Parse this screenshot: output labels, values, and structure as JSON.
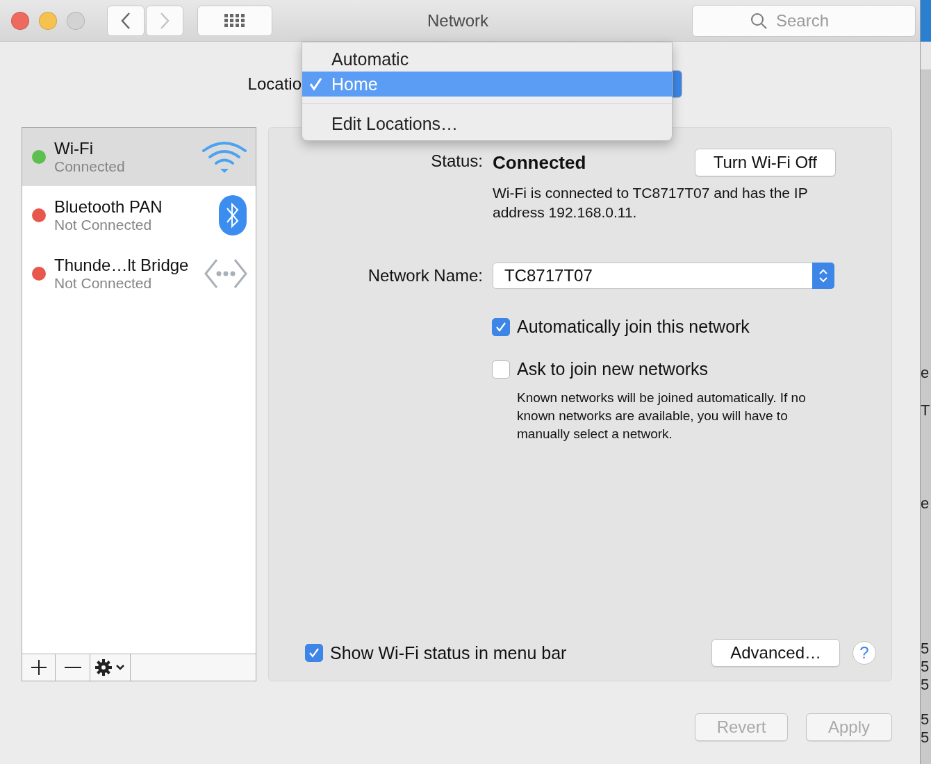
{
  "window": {
    "title": "Network",
    "search_placeholder": "Search"
  },
  "location": {
    "label": "Locatio",
    "menu_items": [
      {
        "label": "Automatic",
        "selected": false
      },
      {
        "label": "Home",
        "selected": true
      }
    ],
    "menu_action": "Edit Locations…"
  },
  "services": [
    {
      "name": "Wi-Fi",
      "status": "Connected",
      "color": "#5cbf4f",
      "selected": true,
      "kind": "wifi"
    },
    {
      "name": "Bluetooth PAN",
      "status": "Not Connected",
      "color": "#e8574b",
      "selected": false,
      "kind": "bluetooth"
    },
    {
      "name": "Thunde…lt Bridge",
      "status": "Not Connected",
      "color": "#e8574b",
      "selected": false,
      "kind": "bridge"
    }
  ],
  "status": {
    "label": "Status:",
    "value": "Connected",
    "description": "Wi-Fi is connected to TC8717T07 and has the IP address 192.168.0.11.",
    "toggle_button": "Turn Wi-Fi Off"
  },
  "network_name": {
    "label": "Network Name:",
    "value": "TC8717T07"
  },
  "options": [
    {
      "label": "Automatically join this network",
      "checked": true
    },
    {
      "label": "Ask to join new networks",
      "checked": false,
      "note": "Known networks will be joined automatically. If no known networks are available, you will have to manually select a network."
    }
  ],
  "menu_bar_option": {
    "label": "Show Wi-Fi status in menu bar",
    "checked": true
  },
  "advanced_button": "Advanced…",
  "help_button": "?",
  "footer_buttons": [
    {
      "label": "Revert",
      "disabled": true
    },
    {
      "label": "Apply",
      "disabled": true
    }
  ],
  "background_window": {
    "fragments": [
      "e",
      "T",
      "e",
      "5",
      "5",
      "5",
      "5",
      "5"
    ]
  }
}
